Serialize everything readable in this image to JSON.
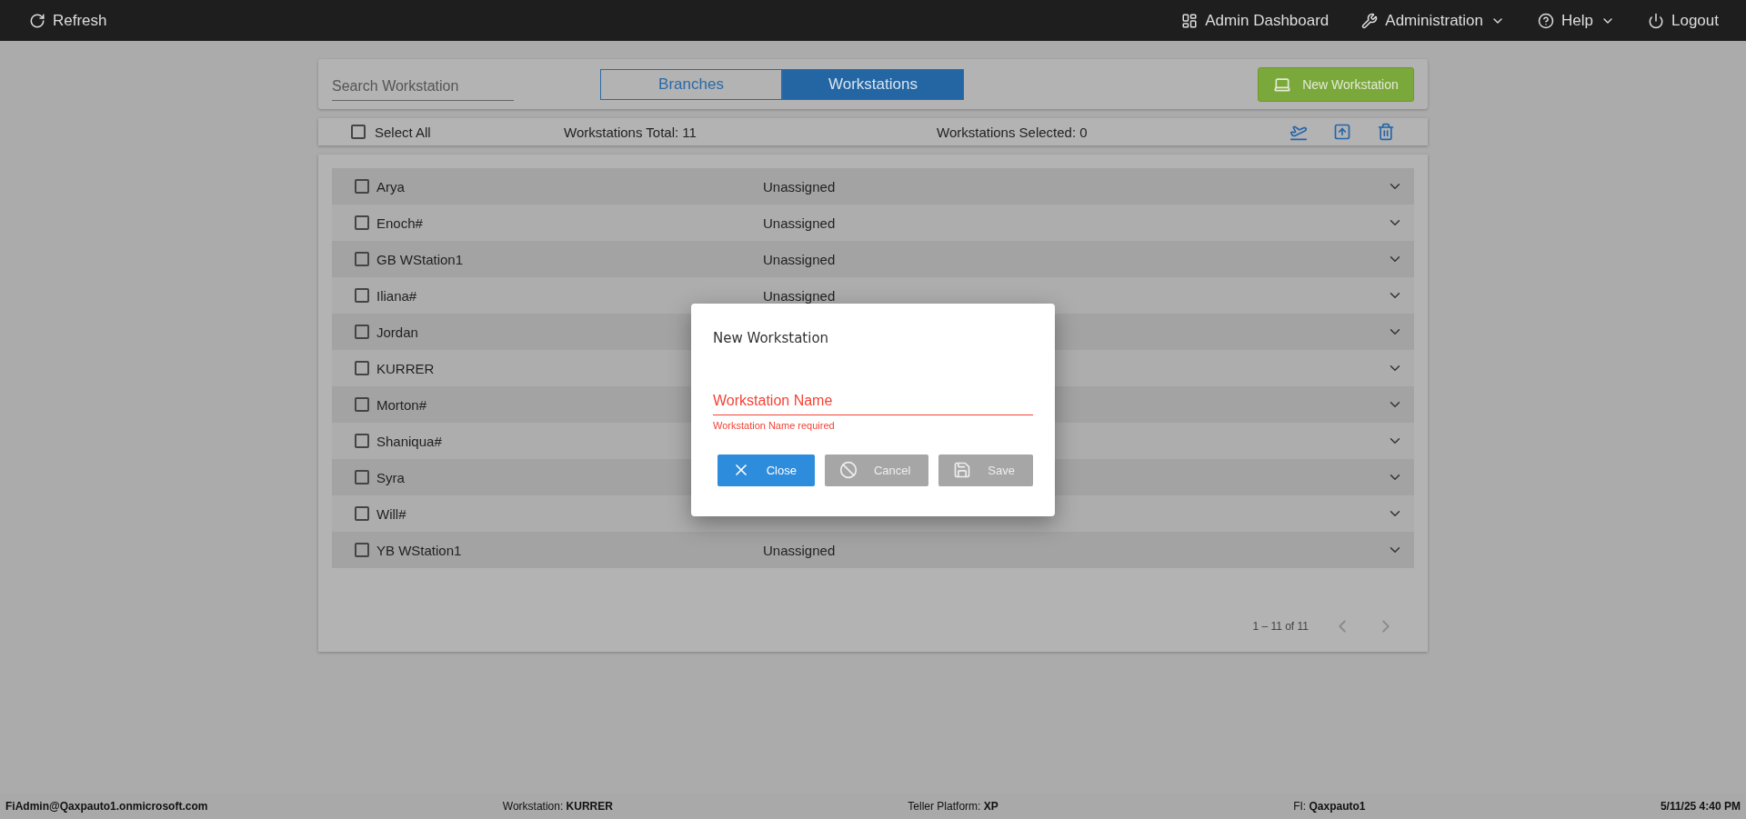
{
  "top_bar": {
    "left": [
      {
        "kind": "refresh",
        "label": "Refresh",
        "dropdown": false
      }
    ],
    "right": [
      {
        "kind": "dashboard",
        "label": "Admin Dashboard",
        "dropdown": false
      },
      {
        "kind": "wrench",
        "label": "Administration",
        "dropdown": true
      },
      {
        "kind": "help",
        "label": "Help",
        "dropdown": true
      },
      {
        "kind": "power",
        "label": "Logout",
        "dropdown": false
      }
    ]
  },
  "search": {
    "placeholder": "Search Workstation"
  },
  "tabs": [
    {
      "label": "Branches",
      "selected": false
    },
    {
      "label": "Workstations",
      "selected": true
    }
  ],
  "new_button": {
    "label": "New Workstation"
  },
  "toolbar": {
    "select_all": {
      "label": "Select All",
      "checked": false
    },
    "total": "Workstations Total: 11",
    "selected_count": "Workstations Selected: 0"
  },
  "rows": [
    {
      "name": "Arya",
      "checked": false,
      "status": "Unassigned"
    },
    {
      "name": "Enoch#",
      "checked": false,
      "status": "Unassigned"
    },
    {
      "name": "GB WStation1",
      "checked": false,
      "status": "Unassigned"
    },
    {
      "name": "Iliana#",
      "checked": false,
      "status": "Unassigned"
    },
    {
      "name": "Jordan",
      "checked": false
    },
    {
      "name": "KURRER",
      "checked": false
    },
    {
      "name": "Morton#",
      "checked": false
    },
    {
      "name": "Shaniqua#",
      "checked": false
    },
    {
      "name": "Syra",
      "checked": false
    },
    {
      "name": "Will#",
      "checked": false
    },
    {
      "name": "YB WStation1",
      "checked": false,
      "status": "Unassigned"
    }
  ],
  "pagination": {
    "range": "1 – 11 of 11"
  },
  "dialog": {
    "title": "New Workstation",
    "field": {
      "placeholder": "Workstation Name",
      "error": "Workstation Name required",
      "invalid": true
    },
    "buttons": [
      {
        "kind": "close",
        "label": "Close",
        "disabled": false
      },
      {
        "kind": "cancel",
        "label": "Cancel",
        "disabled": true
      },
      {
        "kind": "save",
        "label": "Save",
        "disabled": true
      }
    ]
  },
  "status_bar": [
    {
      "value": "FiAdmin@Qaxpauto1.onmicrosoft.com"
    },
    {
      "label": "Workstation:",
      "value": "KURRER"
    },
    {
      "label": "Teller Platform:",
      "value": "XP"
    },
    {
      "label": "FI:",
      "value": "Qaxpauto1"
    },
    {
      "value": "5/11/25 4:40 PM"
    }
  ]
}
